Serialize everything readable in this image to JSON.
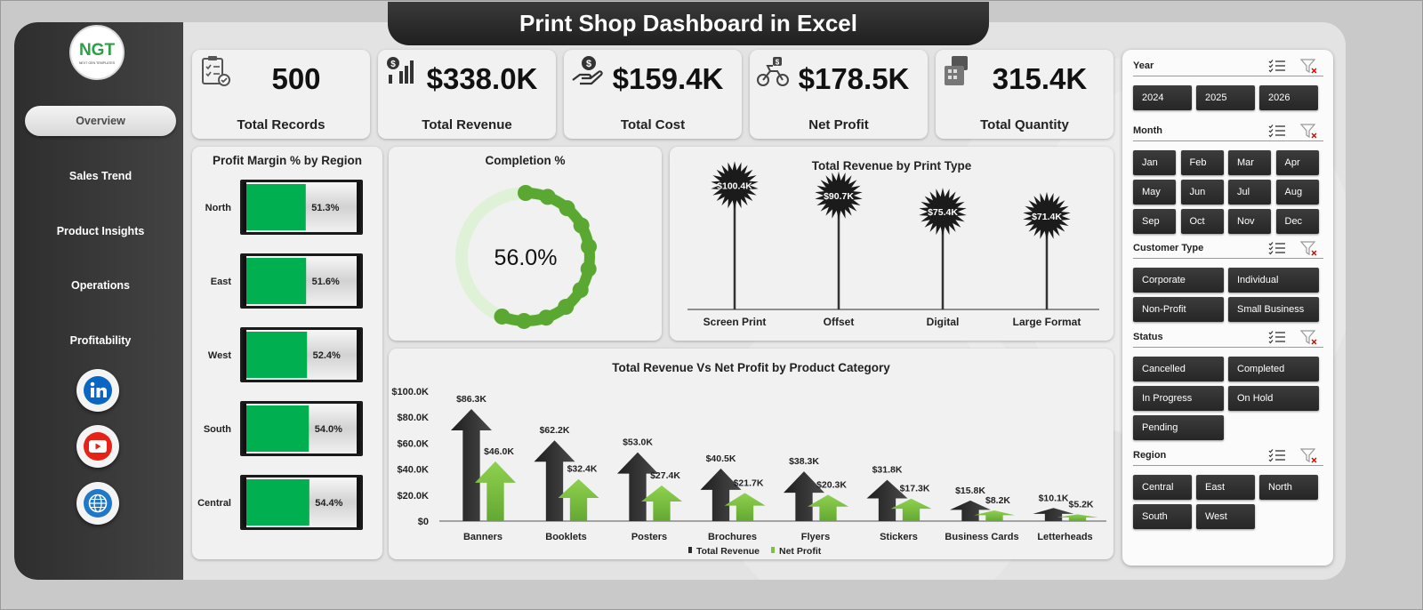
{
  "title": "Print Shop Dashboard in Excel",
  "logo": {
    "text": "NGT",
    "tagline": "NEXT GEN TEMPLATES"
  },
  "nav": [
    {
      "label": "Overview",
      "active": true
    },
    {
      "label": "Sales Trend",
      "active": false
    },
    {
      "label": "Product Insights",
      "active": false
    },
    {
      "label": "Operations",
      "active": false
    },
    {
      "label": "Profitability",
      "active": false
    }
  ],
  "social": [
    {
      "icon": "linkedin-icon",
      "color": "#0a66c2"
    },
    {
      "icon": "youtube-icon",
      "color": "#e62117"
    },
    {
      "icon": "globe-icon",
      "color": "#1f78c8"
    }
  ],
  "kpis": [
    {
      "value": "500",
      "label": "Total Records",
      "icon": "checklist-icon"
    },
    {
      "value": "$338.0K",
      "label": "Total Revenue",
      "icon": "revenue-chart-icon"
    },
    {
      "value": "$159.4K",
      "label": "Total Cost",
      "icon": "cost-hand-icon"
    },
    {
      "value": "$178.5K",
      "label": "Net Profit",
      "icon": "profit-bike-icon"
    },
    {
      "value": "315.4K",
      "label": "Total Quantity",
      "icon": "quantity-box-icon"
    }
  ],
  "colors": {
    "green": "#00b050",
    "light_green": "#7cc242",
    "dark": "#2b2b2b",
    "donut_track": "#dff2d8",
    "donut_fill": "#5aa832"
  },
  "chart_data": [
    {
      "type": "bar",
      "orientation": "horizontal",
      "title": "Profit Margin % by Region",
      "categories": [
        "North",
        "East",
        "West",
        "South",
        "Central"
      ],
      "values": [
        51.3,
        51.6,
        52.4,
        54.0,
        54.4
      ],
      "value_labels": [
        "51.3%",
        "51.6%",
        "52.4%",
        "54.0%",
        "54.4%"
      ],
      "xlim": [
        0,
        100
      ]
    },
    {
      "type": "pie",
      "variant": "donut",
      "title": "Completion %",
      "values": [
        56.0,
        44.0
      ],
      "center_label": "56.0%"
    },
    {
      "type": "bar",
      "variant": "lollipop",
      "title": "Total Revenue  by Print Type",
      "categories": [
        "Screen Print",
        "Offset",
        "Digital",
        "Large Format"
      ],
      "values": [
        100.4,
        90.7,
        75.4,
        71.4
      ],
      "value_labels": [
        "$100.4K",
        "$90.7K",
        "$75.4K",
        "$71.4K"
      ],
      "unit": "K"
    },
    {
      "type": "bar",
      "title": "Total Revenue  Vs Net Profit by Product Category",
      "categories": [
        "Banners",
        "Booklets",
        "Posters",
        "Brochures",
        "Flyers",
        "Stickers",
        "Business Cards",
        "Letterheads"
      ],
      "series": [
        {
          "name": "Total Revenue",
          "values": [
            86.3,
            62.2,
            53.0,
            40.5,
            38.3,
            31.8,
            15.8,
            10.1
          ],
          "labels": [
            "$86.3K",
            "$62.2K",
            "$53.0K",
            "$40.5K",
            "$38.3K",
            "$31.8K",
            "$15.8K",
            "$10.1K"
          ]
        },
        {
          "name": "Net Profit",
          "values": [
            46.0,
            32.4,
            27.4,
            21.7,
            20.3,
            17.3,
            8.2,
            5.2
          ],
          "labels": [
            "$46.0K",
            "$32.4K",
            "$27.4K",
            "$21.7K",
            "$20.3K",
            "$17.3K",
            "$8.2K",
            "$5.2K"
          ]
        }
      ],
      "yticks": [
        "$0",
        "$20.0K",
        "$40.0K",
        "$60.0K",
        "$80.0K",
        "$100.0K"
      ],
      "ylim": [
        0,
        100
      ],
      "legend": "bottom"
    }
  ],
  "slicers": [
    {
      "title": "Year",
      "items": [
        "2024",
        "2025",
        "2026"
      ]
    },
    {
      "title": "Month",
      "items": [
        "Jan",
        "Feb",
        "Mar",
        "Apr",
        "May",
        "Jun",
        "Jul",
        "Aug",
        "Sep",
        "Oct",
        "Nov",
        "Dec"
      ]
    },
    {
      "title": "Customer Type",
      "items": [
        "Corporate",
        "Individual",
        "Non-Profit",
        "Small Business"
      ]
    },
    {
      "title": "Status",
      "items": [
        "Cancelled",
        "Completed",
        "In Progress",
        "On Hold",
        "Pending"
      ]
    },
    {
      "title": "Region",
      "items": [
        "Central",
        "East",
        "North",
        "South",
        "West"
      ]
    }
  ]
}
